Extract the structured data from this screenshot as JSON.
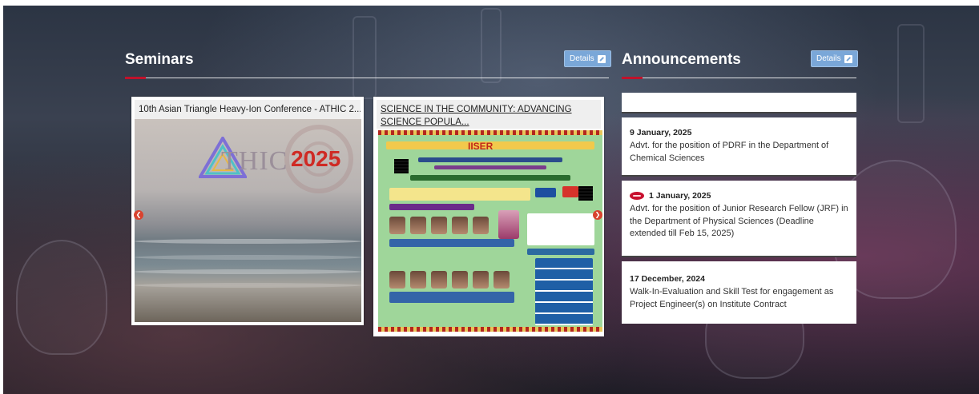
{
  "seminars": {
    "title": "Seminars",
    "details_label": "Details",
    "cards": [
      {
        "caption": "10th Asian Triangle Heavy-Ion Conference - ATHIC 2...",
        "image_text": "THIC",
        "image_year": "2025"
      },
      {
        "caption": "SCIENCE IN THE COMMUNITY: ADVANCING SCIENCE POPULA...",
        "image_brand": "IISER"
      }
    ]
  },
  "announcements": {
    "title": "Announcements",
    "details_label": "Details",
    "items": [
      {
        "date": "9 January, 2025",
        "text": "Advt. for the position of PDRF in the Department of Chemical Sciences",
        "is_new": false
      },
      {
        "date": "1 January, 2025",
        "text": "Advt. for the position of Junior Research Fellow (JRF) in the Department of Physical Sciences (Deadline extended till Feb 15, 2025)",
        "is_new": true
      },
      {
        "date": "17 December, 2024",
        "text": "Walk-In-Evaluation and Skill Test for engagement as Project Engineer(s) on Institute Contract",
        "is_new": false
      }
    ]
  },
  "colors": {
    "accent_red": "#c0122b",
    "details_button": "#7aa7d8",
    "nav_arrow": "#d9432f"
  },
  "icons": {
    "details": "external-link-icon",
    "prev": "chevron-left-icon",
    "next": "chevron-right-icon",
    "new": "new-badge-icon"
  }
}
